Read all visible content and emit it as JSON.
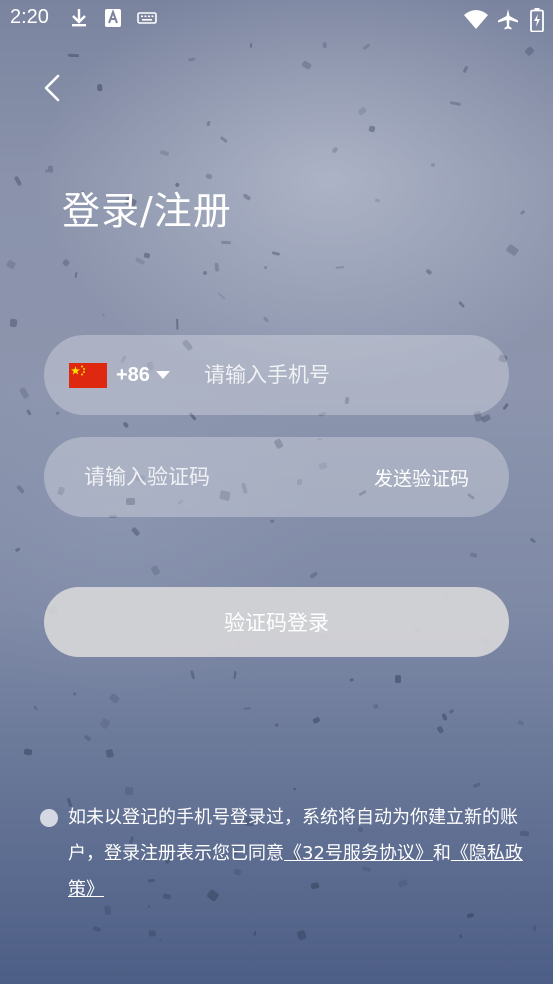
{
  "status_bar": {
    "time": "2:20",
    "left_icons": [
      "download-icon",
      "a-notification-icon",
      "keyboard-icon"
    ],
    "right_icons": [
      "wifi-icon",
      "airplane-mode-icon",
      "battery-charging-icon"
    ]
  },
  "nav": {
    "back_icon": "chevron-left-icon"
  },
  "page": {
    "title": "登录/注册"
  },
  "phone_field": {
    "flag": "china-flag-icon",
    "country_code": "+86",
    "placeholder": "请输入手机号",
    "value": ""
  },
  "code_field": {
    "placeholder": "请输入验证码",
    "value": "",
    "send_label": "发送验证码"
  },
  "login_button": {
    "label": "验证码登录"
  },
  "agreement": {
    "text": "如未以登记的手机号登录过，系统将自动为你建立新的账户，登录注册表示您已同意",
    "service_link": "《32号服务协议》",
    "conjunction": "和",
    "privacy_link": "《隐私政策》",
    "checked": false
  },
  "colors": {
    "background_top": "#7b849f",
    "background_bottom": "#4d5e86",
    "field_bg": "rgba(255,255,255,0.28)",
    "button_bg": "#d6d6d8",
    "text": "#ffffff",
    "flag_red": "#de2910",
    "flag_yellow": "#ffde00"
  }
}
